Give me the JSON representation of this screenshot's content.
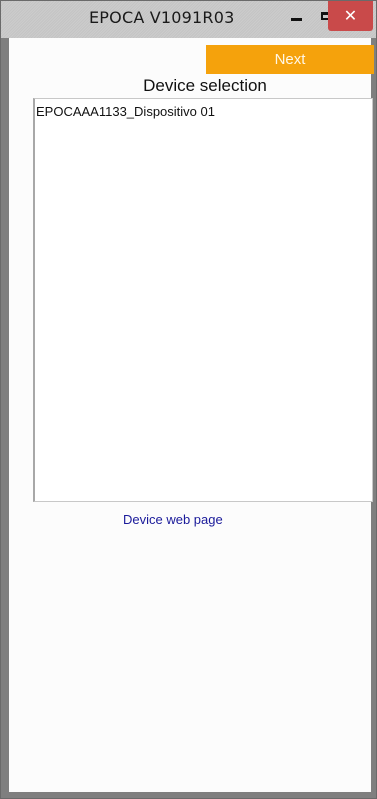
{
  "window": {
    "title": "EPOCA V1091R03",
    "controls": {
      "minimize_icon": "minimize-icon",
      "maximize_icon": "maximize-icon",
      "close_icon": "close-icon",
      "close_glyph": "✕"
    }
  },
  "toolbar": {
    "next_label": "Next"
  },
  "main": {
    "section_title": "Device selection",
    "devices": [
      "EPOCAAA1133_Dispositivo 01"
    ],
    "web_page_link": "Device web page"
  },
  "colors": {
    "accent": "#f5a20c",
    "close_button": "#c94a4a",
    "link": "#1a1a9a",
    "frame": "#7f7f7f"
  }
}
